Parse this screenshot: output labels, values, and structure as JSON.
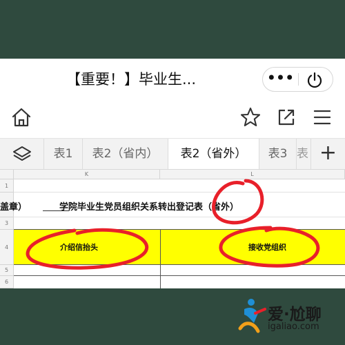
{
  "window": {
    "title": "【重要！】毕业生...",
    "more_label": "•••"
  },
  "tabs": [
    {
      "label": "表1"
    },
    {
      "label": "表2（省内）"
    },
    {
      "label": "表2（省外）"
    },
    {
      "label": "表3"
    },
    {
      "label": "表"
    }
  ],
  "add_tab_label": "+",
  "sheet": {
    "columns": [
      "K",
      "L"
    ],
    "rows": [
      "1",
      "2",
      "3",
      "4",
      "5",
      "6"
    ],
    "stamp_fragment": "盖章）",
    "title": "学院毕业生党员组织关系转出登记表（省外）",
    "header_k": "介绍信抬头",
    "header_l": "接收党组织"
  },
  "watermark": {
    "line1": "爱·尬聊",
    "line2": "igaliao.com"
  },
  "colors": {
    "highlight": "#ffff00",
    "annotation": "#e8202a",
    "tab_bar": "#f2f2f2"
  },
  "icons": [
    "home-icon",
    "star-icon",
    "share-icon",
    "menu-icon",
    "layers-icon",
    "power-icon",
    "more-icon"
  ]
}
